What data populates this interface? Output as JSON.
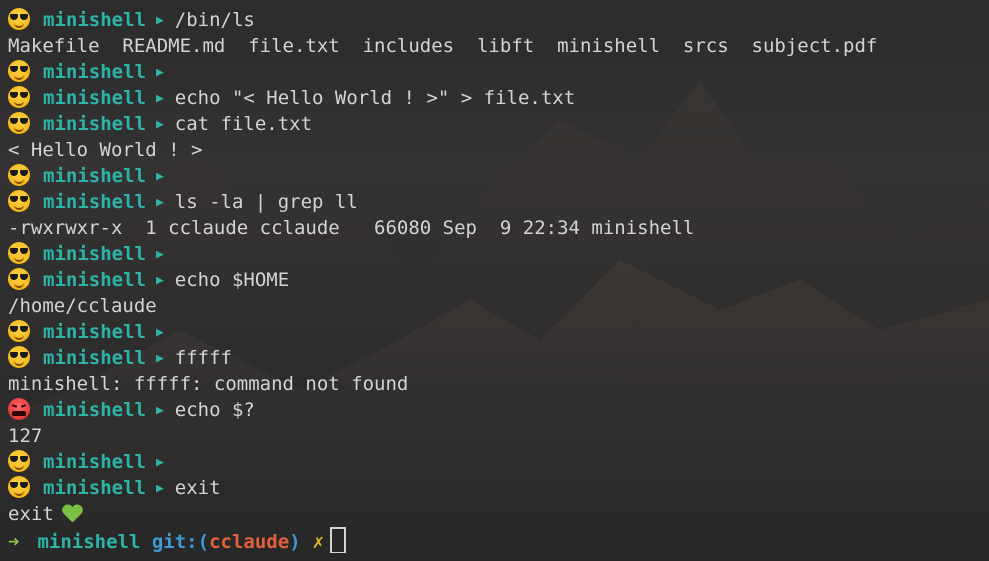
{
  "terminal": {
    "lines": [
      {
        "type": "prompt",
        "emoji": "cool-face-emoji",
        "name": "minishell",
        "cmd": "/bin/ls"
      },
      {
        "type": "output",
        "text": "Makefile  README.md  file.txt  includes  libft  minishell  srcs  subject.pdf"
      },
      {
        "type": "prompt",
        "emoji": "cool-face-emoji",
        "name": "minishell",
        "cmd": ""
      },
      {
        "type": "prompt",
        "emoji": "cool-face-emoji",
        "name": "minishell",
        "cmd": "echo \"< Hello World ! >\" > file.txt"
      },
      {
        "type": "prompt",
        "emoji": "cool-face-emoji",
        "name": "minishell",
        "cmd": "cat file.txt"
      },
      {
        "type": "output",
        "text": "< Hello World ! >"
      },
      {
        "type": "prompt",
        "emoji": "cool-face-emoji",
        "name": "minishell",
        "cmd": ""
      },
      {
        "type": "prompt",
        "emoji": "cool-face-emoji",
        "name": "minishell",
        "cmd": "ls -la | grep ll"
      },
      {
        "type": "output",
        "text": "-rwxrwxr-x  1 cclaude cclaude   66080 Sep  9 22:34 minishell"
      },
      {
        "type": "prompt",
        "emoji": "cool-face-emoji",
        "name": "minishell",
        "cmd": ""
      },
      {
        "type": "prompt",
        "emoji": "cool-face-emoji",
        "name": "minishell",
        "cmd": "echo $HOME"
      },
      {
        "type": "output",
        "text": "/home/cclaude"
      },
      {
        "type": "prompt",
        "emoji": "cool-face-emoji",
        "name": "minishell",
        "cmd": ""
      },
      {
        "type": "prompt",
        "emoji": "cool-face-emoji",
        "name": "minishell",
        "cmd": "fffff"
      },
      {
        "type": "output",
        "text": "minishell: fffff: command not found"
      },
      {
        "type": "prompt",
        "emoji": "angry-face-emoji",
        "name": "minishell",
        "cmd": "echo $?"
      },
      {
        "type": "output",
        "text": "127"
      },
      {
        "type": "prompt",
        "emoji": "cool-face-emoji",
        "name": "minishell",
        "cmd": ""
      },
      {
        "type": "prompt",
        "emoji": "cool-face-emoji",
        "name": "minishell",
        "cmd": "exit"
      },
      {
        "type": "output",
        "text": "exit",
        "icon": "green-heart-icon"
      }
    ],
    "final_prompt": {
      "arrow": "➜",
      "name": "minishell",
      "git_label": "git:(",
      "branch": "cclaude",
      "git_close": ")",
      "dirty_mark": "✗"
    },
    "prompt_symbol": "▶"
  },
  "colors": {
    "prompt_name": "#2ab5a8",
    "git_label": "#3e9bd6",
    "branch": "#e2613b",
    "dirty_mark": "#e4b928",
    "final_arrow": "#8bc34a",
    "text": "#d4d4d4"
  }
}
